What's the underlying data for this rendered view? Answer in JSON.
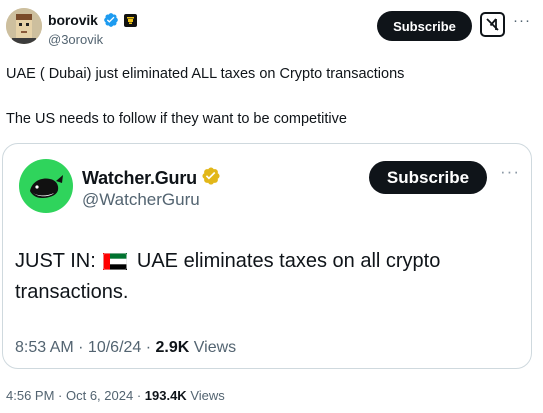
{
  "author": {
    "display_name": "borovik",
    "handle": "@3orovik",
    "verified": true
  },
  "header": {
    "subscribe_label": "Subscribe",
    "grok_icon": "grok-icon",
    "more_icon": "more-icon",
    "more_glyph": "···"
  },
  "tweet": {
    "line1": "UAE ( Dubai) just eliminated ALL taxes on Crypto transactions",
    "line2": "The US needs to follow if they want to be competitive"
  },
  "quote": {
    "display_name": "Watcher.Guru",
    "handle": "@WatcherGuru",
    "verified_color": "#e2b719",
    "subscribe_label": "Subscribe",
    "more_glyph": "···",
    "text_prefix": "JUST IN:",
    "text_rest": "UAE eliminates taxes on all crypto transactions.",
    "time": "8:53 AM",
    "date": "10/6/24",
    "views_count": "2.9K",
    "views_label": "Views",
    "sep": " · "
  },
  "meta": {
    "time": "4:56 PM",
    "date": "Oct 6, 2024",
    "views_count": "193.4K",
    "views_label": "Views",
    "sep": " · "
  },
  "colors": {
    "accent_blue": "#1d9bf0",
    "gold_badge": "#e2b719",
    "watcher_green": "#2fd45c"
  }
}
